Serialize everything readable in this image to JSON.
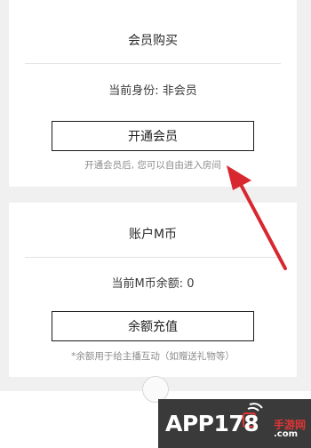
{
  "membership": {
    "title": "会员购买",
    "status": "当前身份: 非会员",
    "button": "开通会员",
    "hint": "开通会员后, 您可以自由进入房间"
  },
  "account": {
    "title": "账户M币",
    "balance": "当前M币余额: 0",
    "button": "余额充值",
    "hint": "*余额用于给主播互动（如赠送礼物等）"
  },
  "watermark": {
    "brand": "APP178",
    "tagline": "手游网",
    "suffix": ".com"
  },
  "colors": {
    "arrow": "#d8272e",
    "page_background": "#f0f0f0",
    "card_background": "#ffffff"
  }
}
